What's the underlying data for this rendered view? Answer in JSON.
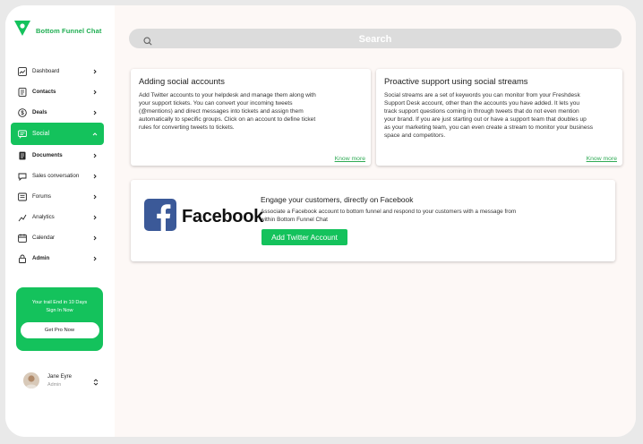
{
  "brand": {
    "name": "Bottom Funnel Chat"
  },
  "sidebar": {
    "items": [
      {
        "label": "Dashboard",
        "icon": "dashboard-icon"
      },
      {
        "label": "Contacts",
        "icon": "contacts-icon"
      },
      {
        "label": "Deals",
        "icon": "deals-icon"
      },
      {
        "label": "Social",
        "icon": "social-icon",
        "active": true
      },
      {
        "label": "Documents",
        "icon": "documents-icon"
      },
      {
        "label": "Sales conversation",
        "icon": "chat-icon"
      },
      {
        "label": "Forums",
        "icon": "forums-icon"
      },
      {
        "label": "Analytics",
        "icon": "analytics-icon"
      },
      {
        "label": "Calendar",
        "icon": "calendar-icon"
      },
      {
        "label": "Admin",
        "icon": "lock-icon"
      }
    ],
    "promo": {
      "line1": "Your trail End in 10 Days",
      "line2": "Sign In Now",
      "button": "Get Pro Now"
    },
    "user": {
      "name": "Jane Eyre",
      "role": "Admin"
    }
  },
  "search": {
    "placeholder": "Search"
  },
  "cards": [
    {
      "title": "Adding social accounts",
      "lines": [
        "Add Twitter accounts to your helpdesk and manage them along with",
        "your support tickets. You can convert your incoming tweets",
        "(@mentions) and direct messages into tickets and assign them",
        "automatically to specific groups. Click on an account to define ticket",
        "rules for converting tweets to tickets."
      ],
      "link": "Know more"
    },
    {
      "title": "Proactive support using social streams",
      "lines": [
        "Social streams are a set of keywords you can monitor from your Freshdesk",
        "Support Desk account, other than the accounts you have added. It lets you",
        "track support questions coming in through tweets that do not even mention",
        "your brand. If you are just starting out or have a support team that doubles up",
        "as your marketing team, you can even create a stream to monitor your business",
        "space and competitors."
      ],
      "link": "Know more"
    }
  ],
  "facebook": {
    "logo_text": "Facebook",
    "title": "Engage your customers, directly on Facebook",
    "desc_lines": [
      "Associate a Facebook account to bottom funnel and respond to your customers with a message from",
      "within Bottom Funnel Chat"
    ],
    "button": "Add Twitter Account"
  },
  "colors": {
    "accent": "#14c25c",
    "facebook": "#3b5998",
    "link": "#2faa55"
  }
}
